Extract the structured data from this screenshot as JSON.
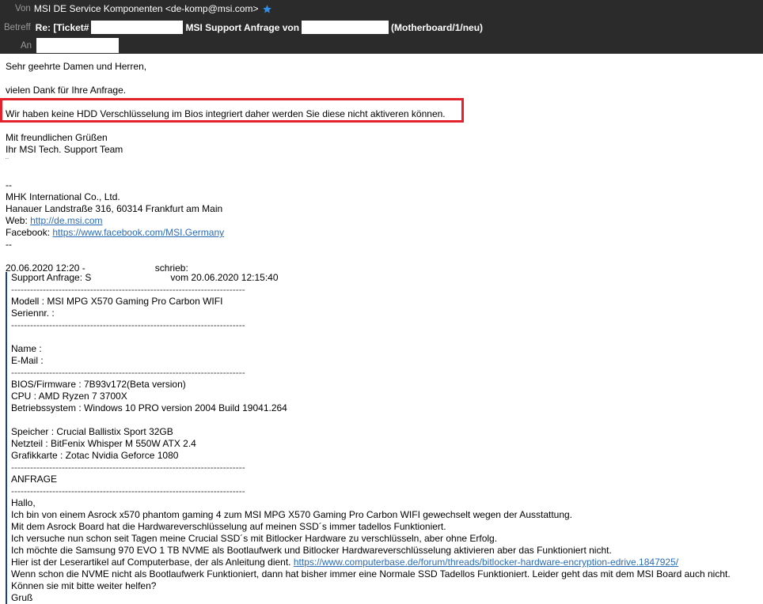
{
  "header": {
    "from_label": "Von",
    "sender": "MSI DE Service Komponenten <de-komp@msi.com>",
    "subject_label": "Betreff",
    "subject_part1": "Re: [Ticket#",
    "subject_part2": "MSI Support Anfrage von",
    "subject_part3": "(Motherboard/1/neu)",
    "to_label": "An",
    "star_color": "#2f8ee8"
  },
  "body": {
    "greeting": "Sehr geehrte Damen und Herren,",
    "thanks": "vielen Dank für Ihre Anfrage.",
    "highlight_text": "Wir haben keine HDD Verschlüsselung im Bios integriert daher werden Sie diese nicht aktiveren können.",
    "closing1": "Mit freundlichen Grüßen",
    "closing2": "Ihr MSI Tech. Support Team",
    "closing3": "¨",
    "sig_dash1": "--",
    "company": "MHK International Co., Ltd.",
    "address": "Hanauer Landstraße 316, 60314 Frankfurt am Main",
    "web_label": "Web: ",
    "web_link": "http://de.msi.com",
    "fb_label": "Facebook: ",
    "fb_link": "https://www.facebook.com/MSI.Germany",
    "sig_dash2": "--",
    "quote_header_date": "20.06.2020 12:20 -",
    "quote_header_wrote": "schrieb:"
  },
  "quote": {
    "line1_a": "Support Anfrage: S",
    "line1_b": "vom 20.06.2020 12:15:40",
    "dash": "--------------------------------------------------------------------------",
    "modell": "Modell : MSI MPG X570 Gaming Pro Carbon WIFI",
    "serien": "Seriennr. :",
    "name": "Name :",
    "email": "E-Mail :",
    "bios": "BIOS/Firmware : 7B93v172(Beta version)",
    "cpu": "CPU : AMD Ryzen 7 3700X",
    "os": "Betriebssystem : Windows 10 PRO version 2004 Build 19041.264",
    "speicher": "Speicher : Crucial Ballistix Sport 32GB",
    "netzteil": "Netzteil : BitFenix Whisper M 550W ATX 2.4",
    "grafik": "Grafikkarte : Zotac Nvidia Geforce 1080",
    "anfrage": "ANFRAGE",
    "hallo": "Hallo,",
    "p1": "Ich bin von einem Asrock x570 phantom gaming 4 zum MSI MPG X570 Gaming Pro Carbon WIFI gewechselt wegen der Ausstattung.",
    "p2": "Mit dem Asrock Board hat die Hardwareverschlüsselung auf meinen SSD´s immer tadellos Funktioniert.",
    "p3": "Ich versuche nun schon seit Tagen meine Crucial SSD´s mit Bitlocker Hardware zu verschlüsseln, aber ohne Erfolg.",
    "p4": "Ich möchte die Samsung 970 EVO 1 TB NVME als Bootlaufwerk und Bitlocker Hardwareverschlüsselung aktivieren aber das Funktioniert nicht.",
    "p5_text": "Hier ist der Leserartikel auf Computerbase, der als Anleitung dient. ",
    "p5_link": "https://www.computerbase.de/forum/threads/bitlocker-hardware-encryption-edrive.1847925/",
    "p6": "Wenn schon die NVME nicht als Bootlaufwerk Funktioniert, dann hat bisher immer eine Normale SSD Tadellos Funktioniert. Leider geht das mit dem MSI Board auch nicht.",
    "p7": "Können sie mit bitte weiter helfen?",
    "p8": "Gruß"
  }
}
